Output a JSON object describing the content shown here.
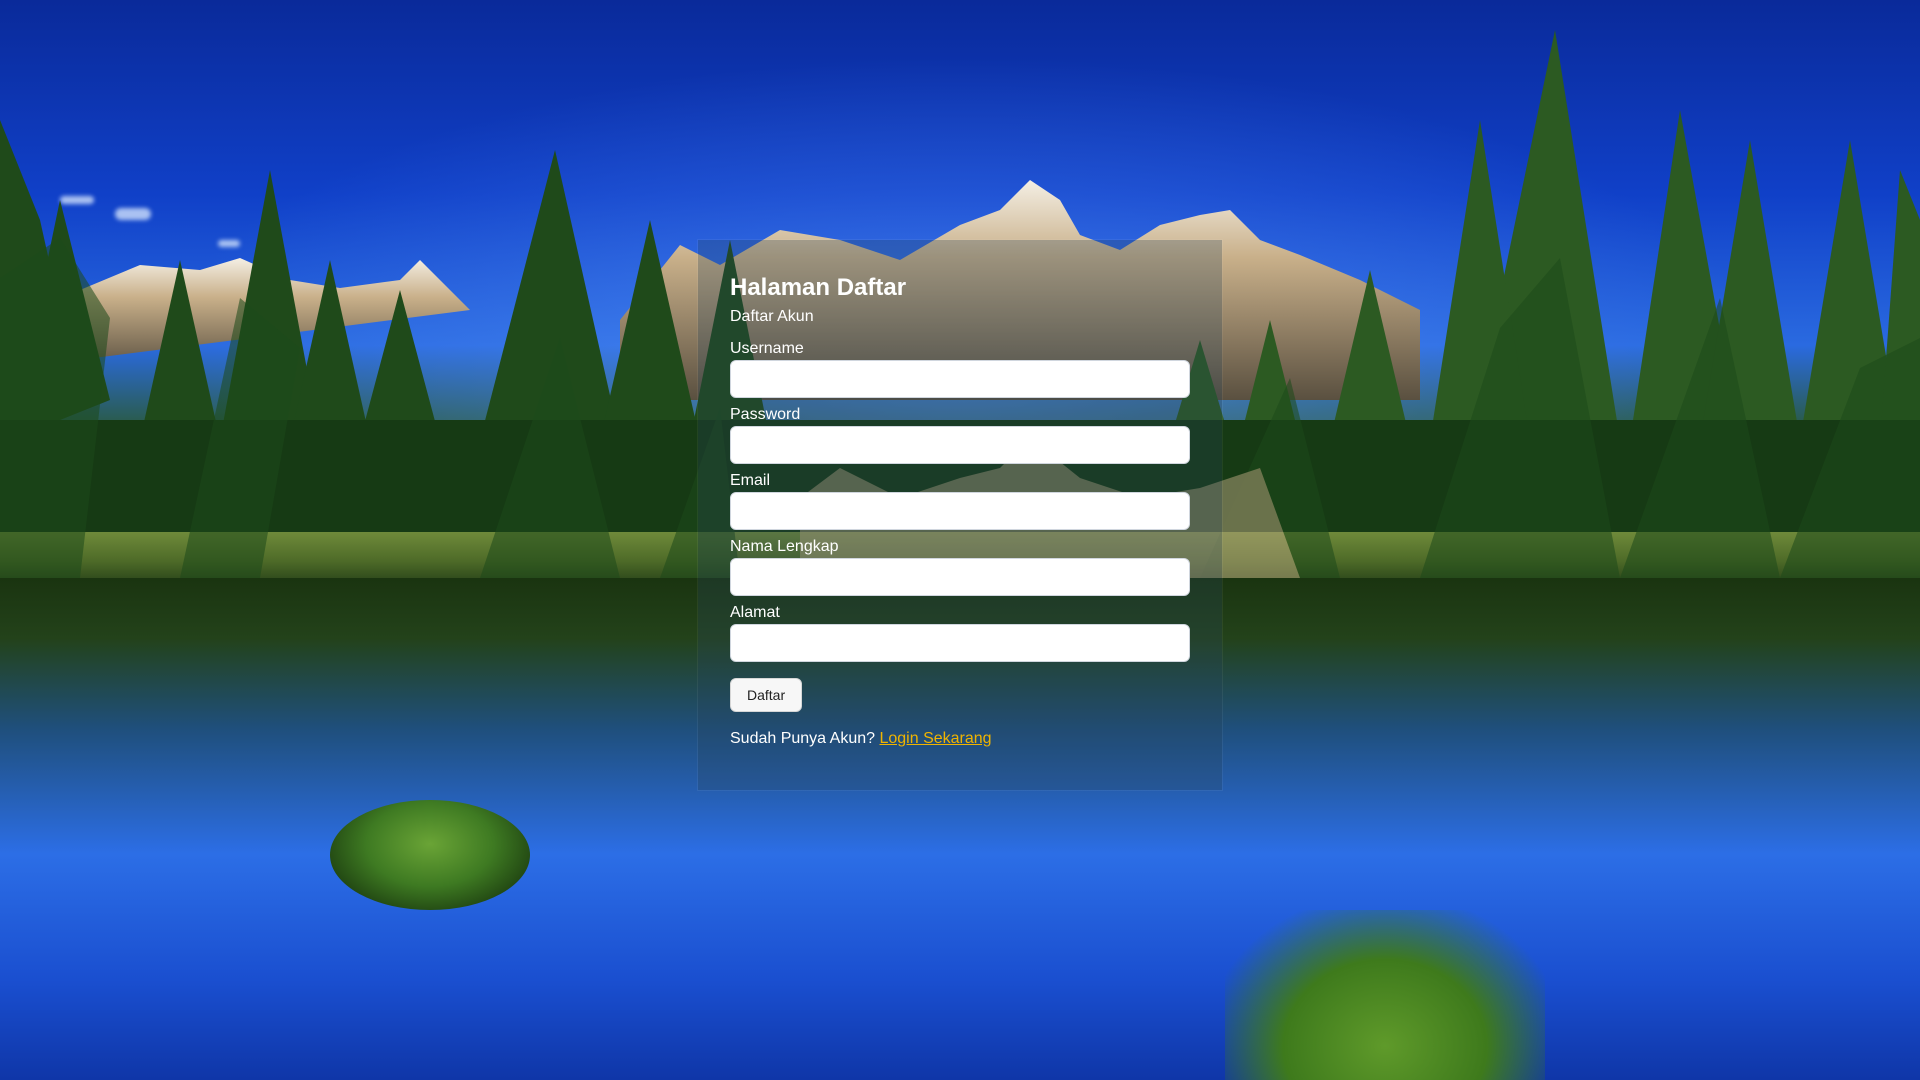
{
  "form": {
    "title": "Halaman Daftar",
    "subtitle": "Daftar Akun",
    "fields": [
      {
        "label": "Username",
        "value": "",
        "placeholder": ""
      },
      {
        "label": "Password",
        "value": "",
        "placeholder": ""
      },
      {
        "label": "Email",
        "value": "",
        "placeholder": ""
      },
      {
        "label": "Nama Lengkap",
        "value": "",
        "placeholder": ""
      },
      {
        "label": "Alamat",
        "value": "",
        "placeholder": ""
      }
    ],
    "submit_label": "Daftar",
    "login_prompt": "Sudah Punya Akun?",
    "login_link": "Login Sekarang"
  },
  "colors": {
    "link": "#f0b400",
    "text": "#ffffff",
    "panel": "rgba(40,70,90,0.28)"
  }
}
